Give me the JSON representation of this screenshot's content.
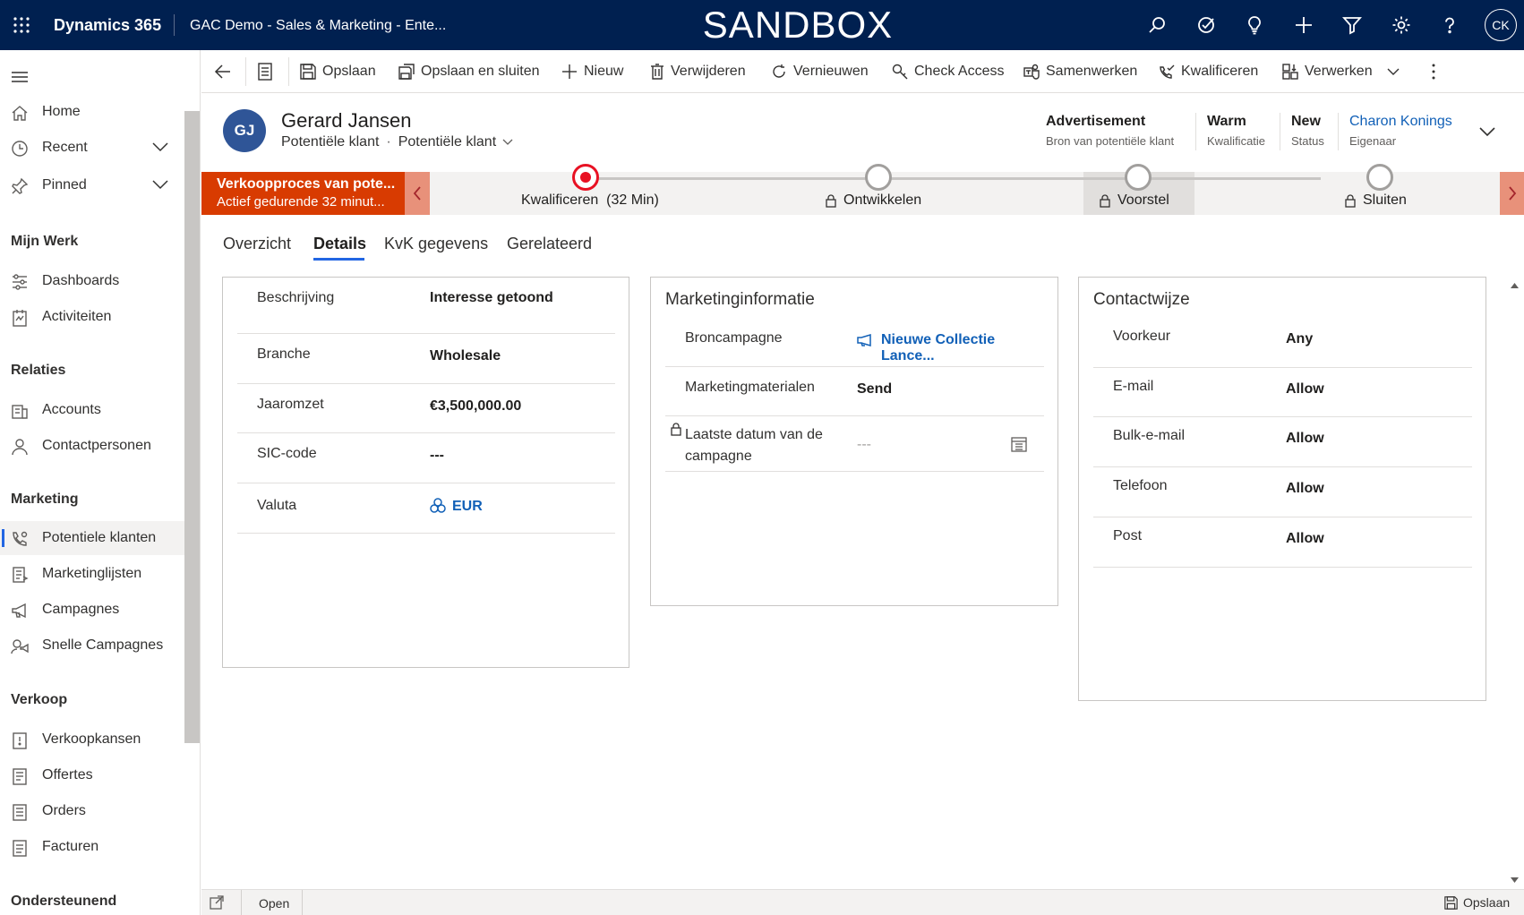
{
  "topbar": {
    "brand": "Dynamics 365",
    "app_title": "GAC Demo - Sales & Marketing - Ente...",
    "environment": "SANDBOX",
    "user_initials": "CK",
    "icons": [
      "search-icon",
      "task-icon",
      "lightbulb-icon",
      "plus-icon",
      "filter-icon",
      "gear-icon",
      "help-icon"
    ]
  },
  "sidebar": {
    "top_items": [
      {
        "label": "Home",
        "icon": "home-icon"
      },
      {
        "label": "Recent",
        "icon": "clock-icon"
      },
      {
        "label": "Pinned",
        "icon": "pin-icon"
      }
    ],
    "groups": [
      {
        "title": "Mijn Werk",
        "items": [
          "Dashboards",
          "Activiteiten"
        ]
      },
      {
        "title": "Relaties",
        "items": [
          "Accounts",
          "Contactpersonen"
        ]
      },
      {
        "title": "Marketing",
        "items": [
          "Potentiele klanten",
          "Marketinglijsten",
          "Campagnes",
          "Snelle Campagnes"
        ]
      },
      {
        "title": "Verkoop",
        "items": [
          "Verkoopkansen",
          "Offertes",
          "Orders",
          "Facturen"
        ]
      },
      {
        "title": "Ondersteunend",
        "items": []
      }
    ],
    "active_item": "Potentiele klanten"
  },
  "commandbar": {
    "save": "Opslaan",
    "save_close": "Opslaan en sluiten",
    "new": "Nieuw",
    "delete": "Verwijderen",
    "refresh": "Vernieuwen",
    "check_access": "Check Access",
    "merge": "Samenwerken",
    "qualify": "Kwalificeren",
    "process": "Verwerken"
  },
  "header": {
    "initials": "GJ",
    "name": "Gerard Jansen",
    "entity": "Potentiële klant",
    "form": "Potentiële klant",
    "fields": [
      {
        "value": "Advertisement",
        "label": "Bron van potentiële klant"
      },
      {
        "value": "Warm",
        "label": "Kwalificatie"
      },
      {
        "value": "New",
        "label": "Status"
      },
      {
        "value": "Charon Konings",
        "label": "Eigenaar"
      }
    ]
  },
  "bpf": {
    "process_name": "Verkoopproces van pote...",
    "process_duration": "Actief gedurende 32 minut...",
    "stages": [
      {
        "name": "Kwalificeren",
        "extra": "(32 Min)",
        "active": true,
        "locked": false
      },
      {
        "name": "Ontwikkelen",
        "active": false,
        "locked": true
      },
      {
        "name": "Voorstel",
        "active": false,
        "locked": true
      },
      {
        "name": "Sluiten",
        "active": false,
        "locked": true
      }
    ]
  },
  "tabs": [
    "Overzicht",
    "Details",
    "KvK gegevens",
    "Gerelateerd"
  ],
  "active_tab": "Details",
  "details_card": {
    "rows": [
      {
        "label": "Beschrijving",
        "value": "Interesse getoond"
      },
      {
        "label": "Branche",
        "value": "Wholesale"
      },
      {
        "label": "Jaaromzet",
        "value": "€3,500,000.00"
      },
      {
        "label": "SIC-code",
        "value": "---"
      },
      {
        "label": "Valuta",
        "value": "EUR"
      }
    ]
  },
  "marketing_card": {
    "title": "Marketinginformatie",
    "rows": [
      {
        "label": "Broncampagne",
        "value": "Nieuwe Collectie Lance..."
      },
      {
        "label": "Marketingmaterialen",
        "value": "Send"
      },
      {
        "label_line1": "Laatste datum van de",
        "label_line2": "campagne",
        "value": "---"
      }
    ]
  },
  "contact_card": {
    "title": "Contactwijze",
    "rows": [
      {
        "label": "Voorkeur",
        "value": "Any"
      },
      {
        "label": "E-mail",
        "value": "Allow"
      },
      {
        "label": "Bulk-e-mail",
        "value": "Allow"
      },
      {
        "label": "Telefoon",
        "value": "Allow"
      },
      {
        "label": "Post",
        "value": "Allow"
      }
    ]
  },
  "statusbar": {
    "status": "Open",
    "save": "Opslaan"
  },
  "colors": {
    "topbar": "#002050",
    "accent": "#2266e3",
    "bpf_flag": "#d83b01",
    "active_stage": "#e81123",
    "link": "#1160b7"
  }
}
